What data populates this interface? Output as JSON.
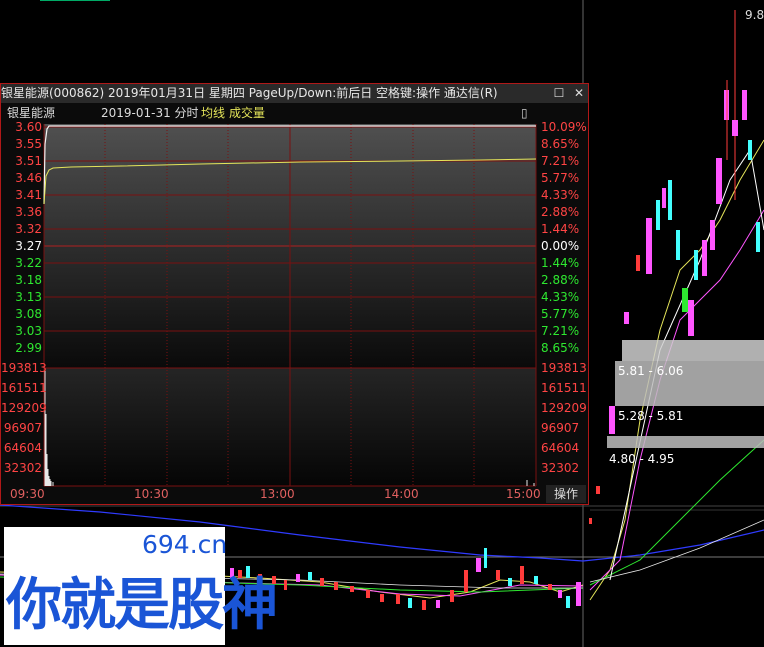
{
  "window": {
    "title": "银星能源(000862) 2019年01月31日 星期四 PageUp/Down:前后日 空格键:操作 通达信(R)",
    "minimize_glyph": "☐",
    "close_glyph": "✕"
  },
  "info_bar": {
    "stock_name": "银星能源",
    "date_label": "2019-01-31 分时",
    "avg_line_label": "均线",
    "volume_label": "成交量",
    "panel_button_glyph": "▯"
  },
  "price_axis": {
    "left": [
      "3.60",
      "3.55",
      "3.51",
      "3.46",
      "3.41",
      "3.36",
      "3.32",
      "3.27",
      "3.22",
      "3.18",
      "3.13",
      "3.08",
      "3.03",
      "2.99"
    ],
    "right": [
      "10.09%",
      "8.65%",
      "7.21%",
      "5.77%",
      "4.33%",
      "2.88%",
      "1.44%",
      "0.00%",
      "1.44%",
      "2.88%",
      "4.33%",
      "5.77%",
      "7.21%",
      "8.65%"
    ]
  },
  "volume_axis": {
    "left": [
      "193813",
      "161511",
      "129209",
      "96907",
      "64604",
      "32302"
    ],
    "right": [
      "193813",
      "161511",
      "129209",
      "96907",
      "64604",
      "32302"
    ]
  },
  "time_axis": [
    "09:30",
    "10:30",
    "13:00",
    "14:00",
    "15:00"
  ],
  "operate_button": "操作",
  "top_right_price": "9.8",
  "price_zones": [
    "5.81 - 6.06",
    "5.28 - 5.81",
    "4.80 - 4.95"
  ],
  "watermark": {
    "site": "694.cn",
    "slogan": "你就是股神"
  },
  "colors": {
    "up": "#ff3b3b",
    "down": "#2ee830",
    "flat": "#ffffff",
    "grid": "#8a1010",
    "avg_line": "#e5e55a",
    "candle_pink": "#ff55ff",
    "candle_cyan": "#44ffff"
  }
}
